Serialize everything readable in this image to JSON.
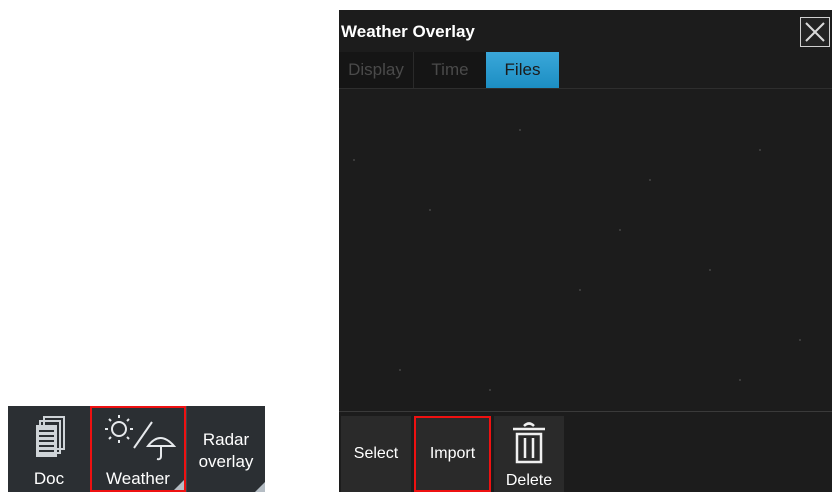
{
  "toolbar": {
    "items": [
      {
        "label": "Doc",
        "icon": "document-icon"
      },
      {
        "label": "Weather",
        "icon": "weather-sun-umbrella-icon",
        "highlighted": true
      },
      {
        "label": "Radar overlay",
        "label_line1": "Radar",
        "label_line2": "overlay",
        "icon": null
      }
    ]
  },
  "panel": {
    "title": "Weather Overlay",
    "close_icon": "close-icon",
    "tabs": [
      {
        "label": "Display",
        "active": false
      },
      {
        "label": "Time",
        "active": false
      },
      {
        "label": "Files",
        "active": true
      }
    ],
    "footer": {
      "select_label": "Select",
      "import_label": "Import",
      "delete_label": "Delete",
      "delete_icon": "trash-icon"
    }
  },
  "colors": {
    "highlight_box": "#ee1111",
    "active_tab": "#2a9bd0",
    "panel_bg": "#1c1c1c",
    "toolbar_bg": "#2b2f33"
  }
}
